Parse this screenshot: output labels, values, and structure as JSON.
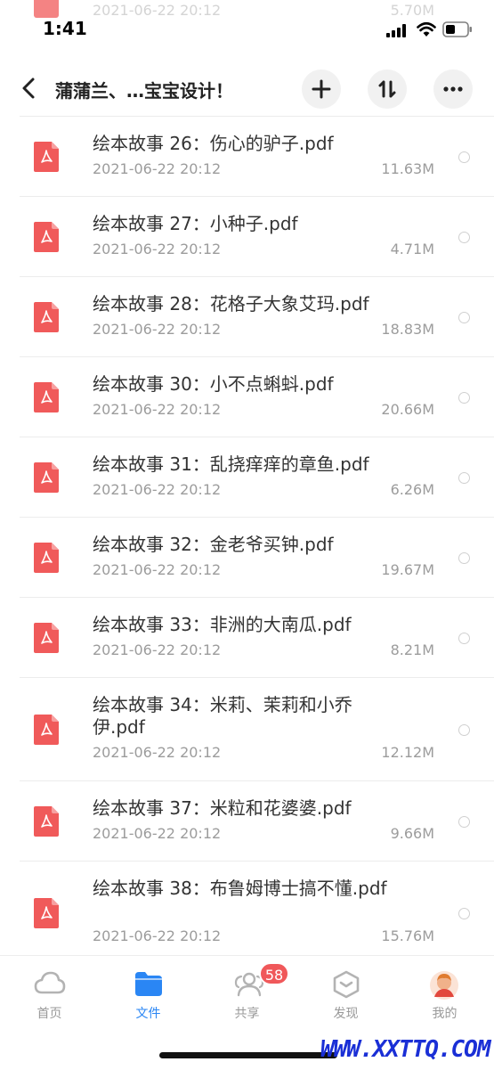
{
  "peek_row": {
    "date": "2021-06-22 20:12",
    "size": "5.70M"
  },
  "status_bar": {
    "time": "1:41"
  },
  "nav": {
    "title": "蒲蒲兰、…宝宝设计！"
  },
  "files": [
    {
      "name": "绘本故事 26：伤心的驴子.pdf",
      "date": "2021-06-22 20:12",
      "size": "11.63M"
    },
    {
      "name": "绘本故事 27：小种子.pdf",
      "date": "2021-06-22 20:12",
      "size": "4.71M"
    },
    {
      "name": "绘本故事 28：花格子大象艾玛.pdf",
      "date": "2021-06-22 20:12",
      "size": "18.83M"
    },
    {
      "name": "绘本故事 30：小不点蝌蚪.pdf",
      "date": "2021-06-22 20:12",
      "size": "20.66M"
    },
    {
      "name": "绘本故事 31：乱挠痒痒的章鱼.pdf",
      "date": "2021-06-22 20:12",
      "size": "6.26M"
    },
    {
      "name": "绘本故事 32：金老爷买钟.pdf",
      "date": "2021-06-22 20:12",
      "size": "19.67M"
    },
    {
      "name": "绘本故事 33：非洲的大南瓜.pdf",
      "date": "2021-06-22 20:12",
      "size": "8.21M"
    },
    {
      "name": "绘本故事 34：米莉、茉莉和小乔伊.pdf",
      "date": "2021-06-22 20:12",
      "size": "12.12M"
    },
    {
      "name": "绘本故事 37：米粒和花婆婆.pdf",
      "date": "2021-06-22 20:12",
      "size": "9.66M"
    },
    {
      "name": "绘本故事 38：布鲁姆博士搞不懂.pdf",
      "date": "2021-06-22 20:12",
      "size": "15.76M"
    }
  ],
  "tabs": [
    {
      "label": "首页",
      "icon": "cloud-icon"
    },
    {
      "label": "文件",
      "icon": "folder-icon",
      "active": true
    },
    {
      "label": "共享",
      "icon": "people-icon",
      "badge": "58"
    },
    {
      "label": "发现",
      "icon": "cube-icon"
    },
    {
      "label": "我的",
      "icon": "avatar"
    }
  ],
  "watermark": "WWW.XXTTQ.COM",
  "colors": {
    "accent": "#2a86f4",
    "pdf_red": "#f05a5a",
    "badge": "#f0585a"
  }
}
